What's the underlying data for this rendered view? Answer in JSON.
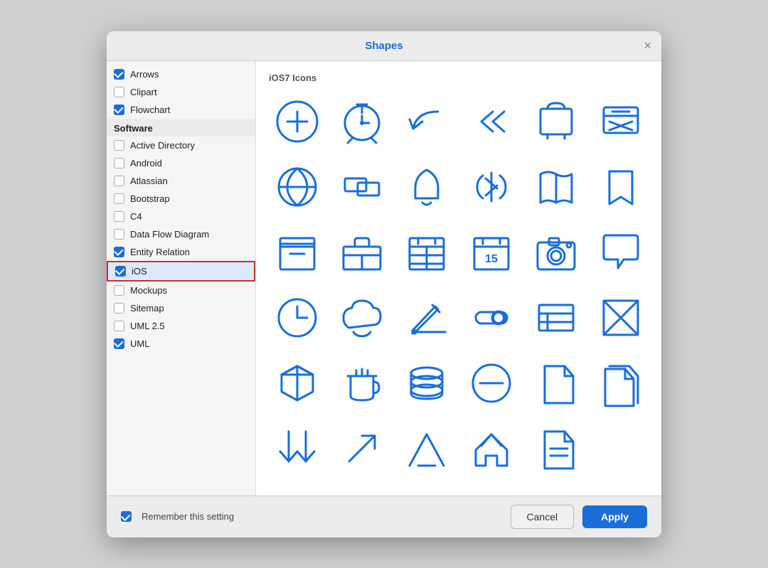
{
  "dialog": {
    "title": "Shapes",
    "close_label": "×"
  },
  "sidebar": {
    "top_items": [
      {
        "id": "arrows",
        "label": "Arrows",
        "checked": true
      },
      {
        "id": "clipart",
        "label": "Clipart",
        "checked": false
      },
      {
        "id": "flowchart",
        "label": "Flowchart",
        "checked": true
      }
    ],
    "section_header": "Software",
    "software_items": [
      {
        "id": "active-directory",
        "label": "Active Directory",
        "checked": false
      },
      {
        "id": "android",
        "label": "Android",
        "checked": false
      },
      {
        "id": "atlassian",
        "label": "Atlassian",
        "checked": false
      },
      {
        "id": "bootstrap",
        "label": "Bootstrap",
        "checked": false
      },
      {
        "id": "c4",
        "label": "C4",
        "checked": false
      },
      {
        "id": "data-flow-diagram",
        "label": "Data Flow Diagram",
        "checked": false
      },
      {
        "id": "entity-relation",
        "label": "Entity Relation",
        "checked": true
      },
      {
        "id": "ios",
        "label": "iOS",
        "checked": true,
        "selected": true,
        "highlighted": true
      },
      {
        "id": "mockups",
        "label": "Mockups",
        "checked": false
      },
      {
        "id": "sitemap",
        "label": "Sitemap",
        "checked": false
      },
      {
        "id": "uml-25",
        "label": "UML 2.5",
        "checked": false
      },
      {
        "id": "uml",
        "label": "UML",
        "checked": true
      }
    ]
  },
  "content": {
    "section_title": "iOS7 Icons"
  },
  "footer": {
    "remember_label": "Remember this setting",
    "cancel_label": "Cancel",
    "apply_label": "Apply"
  }
}
